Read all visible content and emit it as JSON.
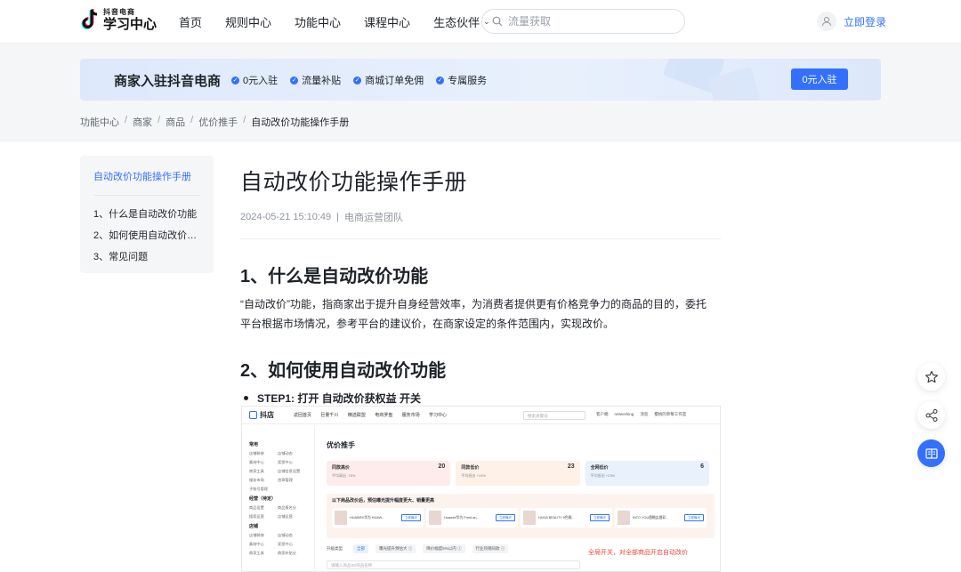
{
  "header": {
    "logo_small": "抖音电商",
    "logo_big": "学习中心",
    "nav": [
      "首页",
      "规则中心",
      "功能中心",
      "课程中心",
      "生态伙伴"
    ],
    "search_placeholder": "流量获取",
    "login": "立即登录"
  },
  "banner": {
    "title": "商家入驻抖音电商",
    "tags": [
      "0元入驻",
      "流量补贴",
      "商城订单免佣",
      "专属服务"
    ],
    "button": "0元入驻"
  },
  "breadcrumb": [
    "功能中心",
    "商家",
    "商品",
    "优价推手",
    "自动改价功能操作手册"
  ],
  "toc": {
    "title": "自动改价功能操作手册",
    "items": [
      "1、什么是自动改价功能",
      "2、如何使用自动改价功能",
      "3、常见问题"
    ]
  },
  "article": {
    "title": "自动改价功能操作手册",
    "date": "2024-05-21 15:10:49",
    "author": "电商运营团队",
    "h1": "1、什么是自动改价功能",
    "para": "“自动改价”功能，指商家出于提升自身经营效率，为消费者提供更有价格竞争力的商品的目的，委托平台根据市场情况，参考平台的建议价，在商家设定的条件范围内，实现改价。",
    "h2": "2、如何使用自动改价功能",
    "step1": "STEP1: 打开 自动改价获权益 开关"
  },
  "screenshot": {
    "logo": "抖店",
    "nav": [
      "返回首页",
      "巨量千川",
      "精选联盟",
      "电商罗盘",
      "服务市场",
      "学习中心"
    ],
    "search": "搜索关键词",
    "right": [
      "客户端",
      "networking",
      "消息",
      "樱桃的草莓工作室"
    ],
    "side_sections": [
      "常用",
      "经营（待定）",
      "店铺"
    ],
    "side_rows": [
      [
        "店铺装修",
        "店铺动态"
      ],
      [
        "素材中心",
        "奖惩中心"
      ],
      [
        "商家工具",
        "店铺信息设置"
      ],
      [
        "服务市场",
        "违章管理"
      ],
      [
        "子账号管理",
        ""
      ]
    ],
    "side_rows2": [
      [
        "商品设置",
        "商品报名分"
      ],
      [
        "搜索运营",
        "店铺运营"
      ]
    ],
    "side_rows3": [
      [
        "店铺装修",
        "店铺动态"
      ],
      [
        "素材中心",
        "奖惩中心"
      ],
      [
        "商家工具",
        "商家补贴分"
      ]
    ],
    "heading": "优价推手",
    "cards": [
      {
        "title": "同款高价",
        "count": "20",
        "sub": "平均高出 -78%"
      },
      {
        "title": "同款低价",
        "count": "23",
        "sub": "平均低出 +15%"
      },
      {
        "title": "全网低价",
        "count": "6",
        "sub": "平均低出 +23%"
      }
    ],
    "promo": "以下商品改价后，预估曝光提升幅度更大、销量更高",
    "products": [
      "HUAWEI/华为 HUAW...",
      "Huawei/华为 FreeLan...",
      "HUDA BEAUTY 9色眼...",
      "INTO YOU唇釉女唇彩..."
    ],
    "product_btn": "立即曝光",
    "filters": [
      "升级类型",
      "全部",
      "曝光提升预估大 ⓘ",
      "降价幅度5%以内 ⓘ",
      "行业热销同款 ⓘ"
    ],
    "input": "请输入商品ID/商品名称",
    "note": "全局开关，对全部商品开启自动改价"
  },
  "colors": {
    "accent": "#3370ff",
    "note_red": "#f04438"
  }
}
